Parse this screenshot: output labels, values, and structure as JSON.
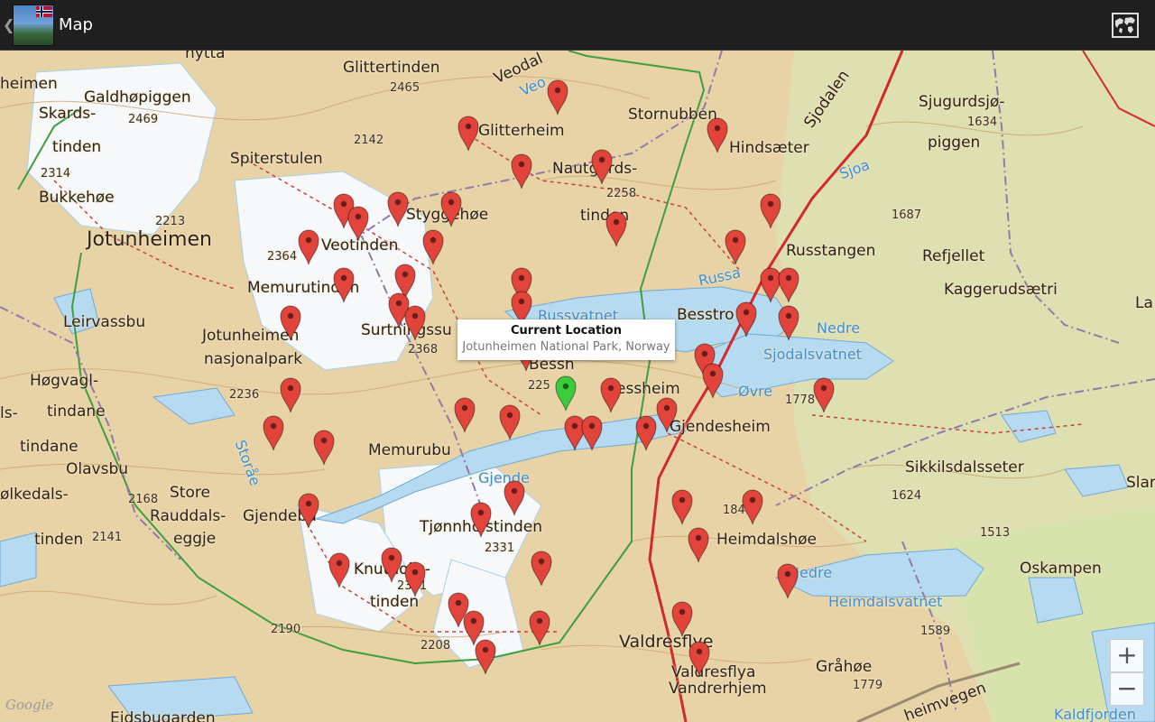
{
  "app": {
    "title": "Map",
    "icons": {
      "up": "chevron-left-icon",
      "app": "app-logo-icon",
      "map_type": "world-map-icon"
    }
  },
  "info_window": {
    "title": "Current Location",
    "subtitle": "Jotunheimen National Park, Norway"
  },
  "zoom": {
    "in_label": "+",
    "out_label": "−"
  },
  "attribution": "Google",
  "colors": {
    "marker": "#e2433a",
    "current_marker": "#3bcc3b",
    "terrain": "#e9d6ad",
    "water": "#b9dcf0",
    "action_bar": "#1f1f1f"
  },
  "map_labels": [
    "nytta",
    "Glittertinden",
    "2465",
    "Veodal",
    "Veo",
    "Stornubben",
    "Sjodalen",
    "Sjugurdsjø-",
    "1634",
    "piggen",
    "heimen",
    "Galdhøpiggen",
    "Skards-",
    "2469",
    "tinden",
    "2314",
    "Bukkehøe",
    "2213",
    "Spiterstulen",
    "2142",
    "Glitterheim",
    "Nautgards-",
    "2258",
    "tinden",
    "Hindsæter",
    "Sjoa",
    "1687",
    "Jotunheimen",
    "Styggehøe",
    "2364",
    "Veotinden",
    "Memurutinden",
    "Russtangen",
    "Refjellet",
    "Kaggerudsætri",
    "Leirvassbu",
    "Jotunheimen",
    "nasjonalpark",
    "Surtningssu",
    "2368",
    "Russvatnet",
    "Besstro",
    "Russa",
    "Nedre",
    "Sjodalsvatnet",
    "Høgvagl-",
    "tindane",
    "2236",
    "Bessh",
    "225",
    "essheim",
    "Øvre",
    "1778",
    "Gjendesheim",
    "ls-",
    "tindane",
    "Olavsbu",
    "Memurubu",
    "Storåe",
    "Sikkilsdalsseter",
    "Gjende",
    "ølkedals-",
    "2168",
    "Store",
    "Rauddals-",
    "eggje",
    "Gjendebu",
    "Tjønnholstinden",
    "2331",
    "184",
    "1624",
    "1513",
    "tinden",
    "2141",
    "Heimdalshøe",
    "Knutholls-",
    "tinden",
    "2341",
    "Nedre",
    "Heimdalsvatnet",
    "Oskampen",
    "2190",
    "2208",
    "Valdresflye",
    "1589",
    "Gråhøe",
    "1779",
    "Valdresflya",
    "Vandrerhjem",
    "Eidsbugarden",
    "heimvegen",
    "Kaldfjorden",
    "La",
    "Slar"
  ],
  "marker_count": 55
}
